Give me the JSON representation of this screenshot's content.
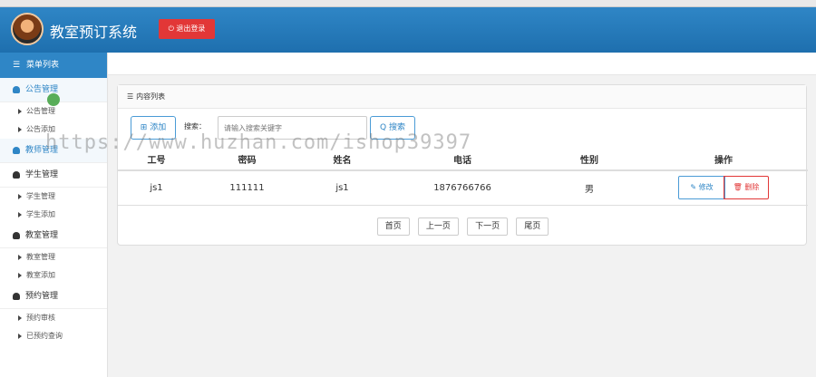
{
  "header": {
    "app_title": "教室预订系统",
    "logout_label": "⏻ 退出登录"
  },
  "sidebar": {
    "heading": "菜单列表",
    "groups": [
      {
        "label": "公告管理",
        "items": [
          "公告管理",
          "公告添加"
        ]
      },
      {
        "label": "教师管理",
        "items": []
      },
      {
        "label": "学生管理",
        "items": [
          "学生管理",
          "学生添加"
        ]
      },
      {
        "label": "教室管理",
        "items": [
          "教室管理",
          "教室添加"
        ]
      },
      {
        "label": "预约管理",
        "items": [
          "预约审核",
          "已预约查询"
        ]
      }
    ]
  },
  "panel": {
    "title": "内容列表",
    "add_label": "⊞ 添加",
    "search_label": "搜索：",
    "search_placeholder": "请输入搜索关键字",
    "search_button": "Q 搜索"
  },
  "table": {
    "columns": [
      "工号",
      "密码",
      "姓名",
      "电话",
      "性别",
      "操作"
    ],
    "rows": [
      {
        "id": "js1",
        "password": "111111",
        "name": "js1",
        "phone": "1876766766",
        "gender": "男"
      }
    ],
    "edit_label": "✎ 修改",
    "delete_label": "🗑 删除"
  },
  "pager": {
    "first": "首页",
    "prev": "上一页",
    "next": "下一页",
    "last": "尾页"
  },
  "watermark": "https://www.huzhan.com/ishop39397",
  "colors": {
    "accent": "#2f86c6",
    "danger": "#e23737"
  }
}
